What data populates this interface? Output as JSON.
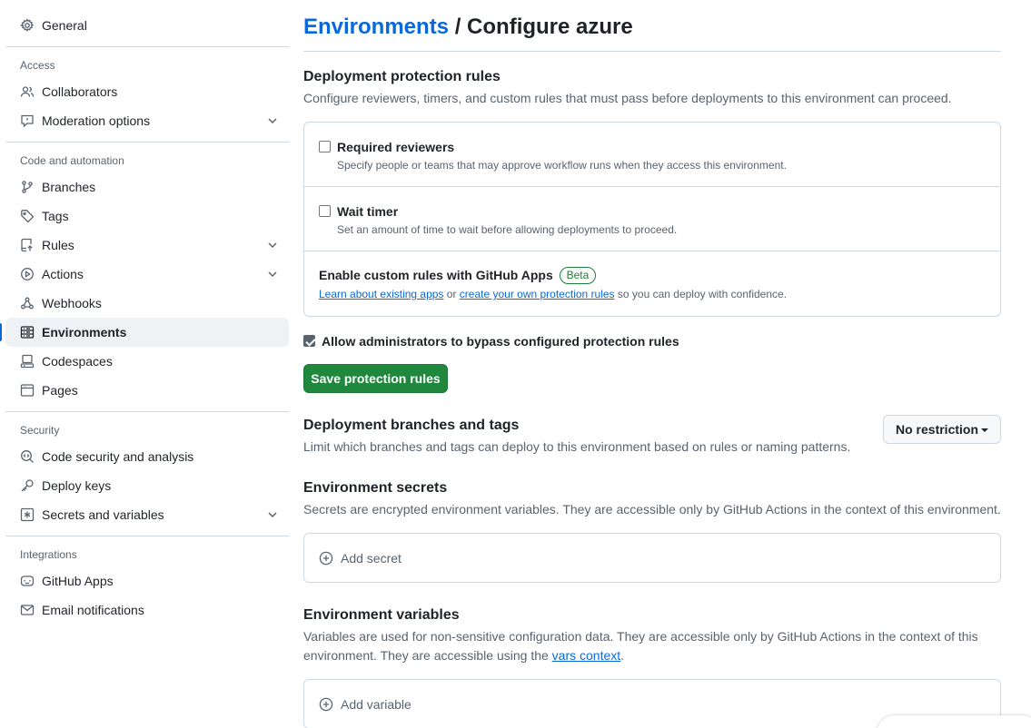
{
  "sidebar": {
    "general": "General",
    "sections": {
      "access": "Access",
      "code_automation": "Code and automation",
      "security": "Security",
      "integrations": "Integrations"
    },
    "items": {
      "collaborators": "Collaborators",
      "moderation": "Moderation options",
      "branches": "Branches",
      "tags": "Tags",
      "rules": "Rules",
      "actions": "Actions",
      "webhooks": "Webhooks",
      "environments": "Environments",
      "codespaces": "Codespaces",
      "pages": "Pages",
      "code_security": "Code security and analysis",
      "deploy_keys": "Deploy keys",
      "secrets": "Secrets and variables",
      "github_apps": "GitHub Apps",
      "email": "Email notifications"
    },
    "active_item": "Environments"
  },
  "header": {
    "breadcrumb_link": "Environments",
    "separator": "/",
    "title": "Configure azure"
  },
  "protection": {
    "heading": "Deployment protection rules",
    "description": "Configure reviewers, timers, and custom rules that must pass before deployments to this environment can proceed.",
    "required_reviewers": {
      "label": "Required reviewers",
      "note": "Specify people or teams that may approve workflow runs when they access this environment.",
      "checked": false
    },
    "wait_timer": {
      "label": "Wait timer",
      "note": "Set an amount of time to wait before allowing deployments to proceed.",
      "checked": false
    },
    "custom_rules": {
      "label": "Enable custom rules with GitHub Apps",
      "badge": "Beta",
      "link1": "Learn about existing apps",
      "or": "or",
      "link2": "create your own protection rules",
      "suffix": "so you can deploy with confidence."
    },
    "admin_bypass": {
      "label": "Allow administrators to bypass configured protection rules",
      "checked": true
    },
    "save_button": "Save protection rules"
  },
  "branches": {
    "heading": "Deployment branches and tags",
    "description": "Limit which branches and tags can deploy to this environment based on rules or naming patterns.",
    "select_value": "No restriction"
  },
  "secrets": {
    "heading": "Environment secrets",
    "description": "Secrets are encrypted environment variables. They are accessible only by GitHub Actions in the context of this environment.",
    "add_label": "Add secret"
  },
  "variables": {
    "heading": "Environment variables",
    "description_line1": "Variables are used for non-sensitive configuration data. They are accessible only by GitHub Actions in the context of this",
    "description_line2_prefix": "environment. They are accessible using the",
    "description_link": "vars context",
    "description_line2_suffix": ".",
    "add_label": "Add variable"
  },
  "colors": {
    "accent": "#0969da",
    "primary_button": "#1f883d",
    "beta_badge": "#1a7f37",
    "muted_text": "#59636e",
    "border": "#d1d9e0"
  }
}
